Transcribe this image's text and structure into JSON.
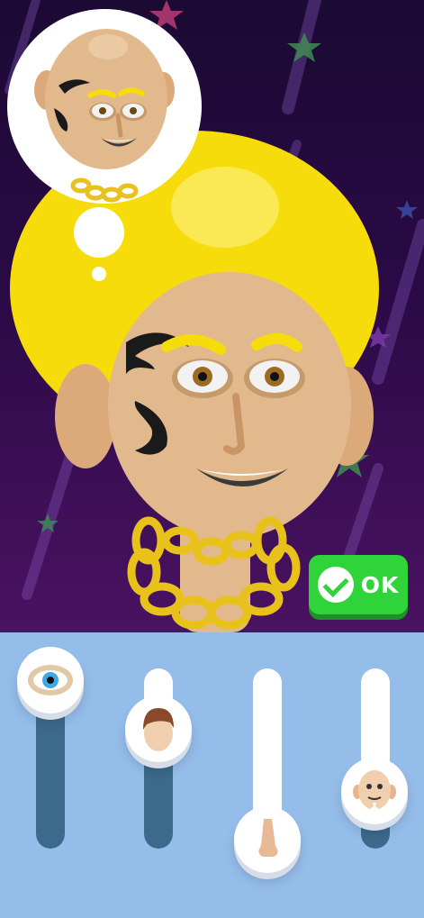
{
  "game": {
    "ok_button": {
      "label": "OK"
    },
    "colors": {
      "accent": "#2fd33a",
      "panel": "#95bdea",
      "slider_fill": "#3c6a8c",
      "hair": "#f5dc0a",
      "skin": "#e2b98c"
    },
    "sliders": [
      {
        "name": "eye",
        "icon": "eye-icon",
        "level": 0.95
      },
      {
        "name": "hair",
        "icon": "hair-icon",
        "level": 0.75
      },
      {
        "name": "nose",
        "icon": "nose-icon",
        "level": 0.1
      },
      {
        "name": "head",
        "icon": "head-icon",
        "level": 0.3
      }
    ]
  }
}
